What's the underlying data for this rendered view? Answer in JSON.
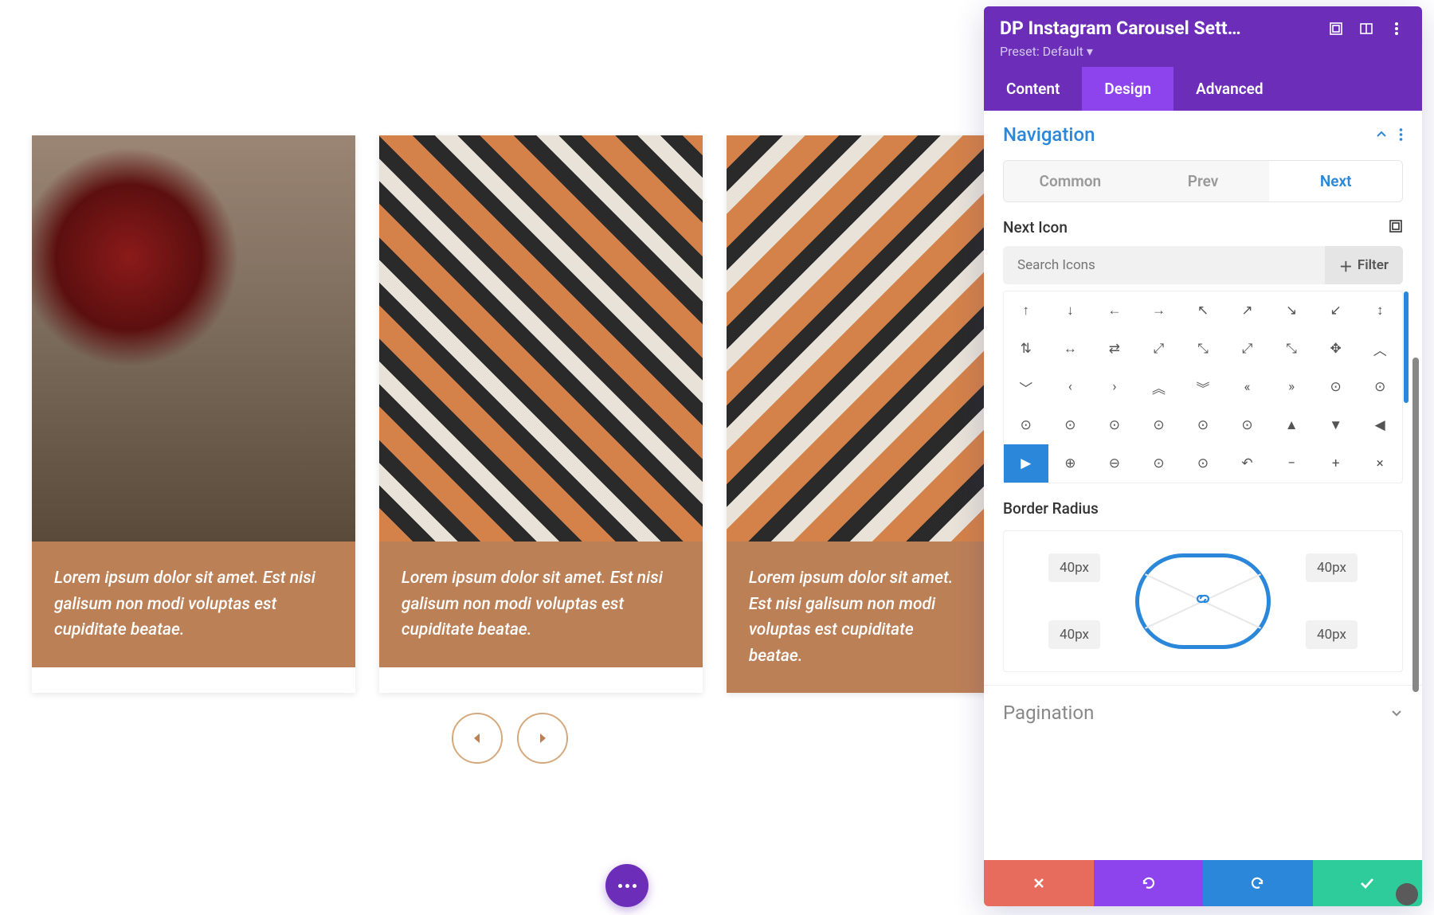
{
  "carousel": {
    "cards": [
      {
        "caption": "Lorem ipsum dolor sit amet. Est nisi galisum non modi voluptas est cupiditate beatae."
      },
      {
        "caption": "Lorem ipsum dolor sit amet. Est nisi galisum non modi voluptas est cupiditate beatae."
      },
      {
        "caption": "Lorem ipsum dolor sit amet. Est nisi galisum non modi voluptas est cupiditate beatae."
      }
    ]
  },
  "panel": {
    "title": "DP Instagram Carousel Sett…",
    "preset_label": "Preset: Default",
    "tabs": {
      "content": "Content",
      "design": "Design",
      "advanced": "Advanced"
    },
    "section_nav_title": "Navigation",
    "subtabs": {
      "common": "Common",
      "prev": "Prev",
      "next": "Next"
    },
    "next_icon_label": "Next Icon",
    "search_placeholder": "Search Icons",
    "filter_label": "Filter",
    "icons": [
      "↑",
      "↓",
      "←",
      "→",
      "↖",
      "↗",
      "↘",
      "↙",
      "↕",
      "⇅",
      "↔",
      "⇄",
      "⤢",
      "⤡",
      "⤢",
      "⤡",
      "✥",
      "︿",
      "﹀",
      "‹",
      "›",
      "︽",
      "︾",
      "«",
      "»",
      "⊙",
      "⊙",
      "⊙",
      "⊙",
      "⊙",
      "⊙",
      "⊙",
      "⊙",
      "▲",
      "▼",
      "◀",
      "▶",
      "⊕",
      "⊖",
      "⊙",
      "⊙",
      "↶",
      "−",
      "+",
      "×"
    ],
    "selected_icon_index": 36,
    "border_radius_label": "Border Radius",
    "border_radius": {
      "tl": "40px",
      "tr": "40px",
      "bl": "40px",
      "br": "40px"
    },
    "section_pagination_title": "Pagination"
  }
}
